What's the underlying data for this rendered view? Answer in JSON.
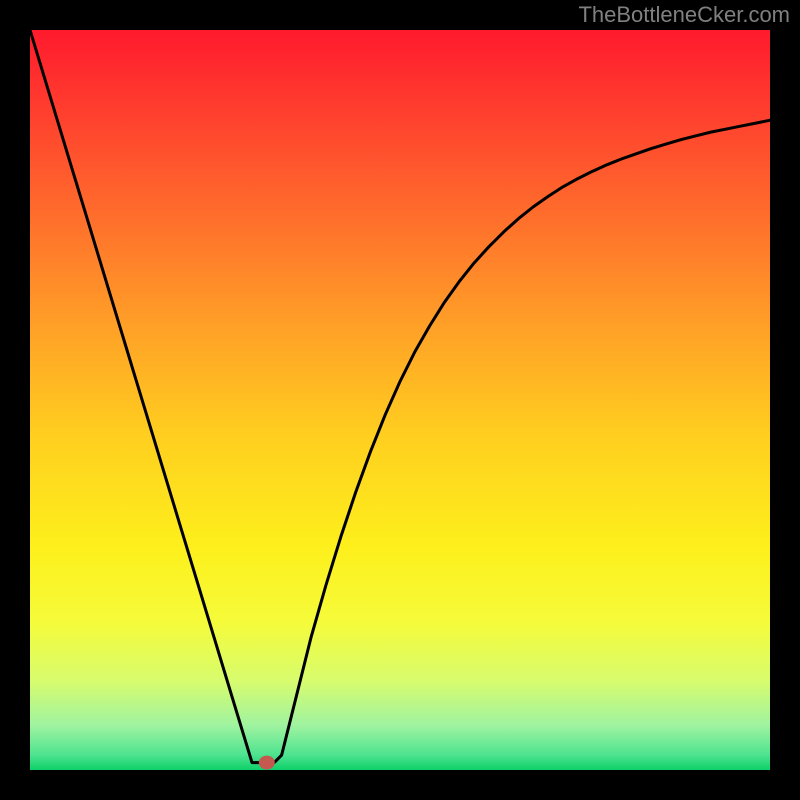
{
  "watermark": "TheBottleneCker.com",
  "chart_data": {
    "type": "line",
    "title": "",
    "xlabel": "",
    "ylabel": "",
    "xlim": [
      0,
      1
    ],
    "ylim": [
      0,
      1
    ],
    "x": [
      0.0,
      0.02,
      0.04,
      0.06,
      0.08,
      0.1,
      0.12,
      0.14,
      0.16,
      0.18,
      0.2,
      0.22,
      0.24,
      0.26,
      0.28,
      0.29,
      0.3,
      0.31,
      0.32,
      0.33,
      0.34,
      0.36,
      0.38,
      0.4,
      0.42,
      0.44,
      0.46,
      0.48,
      0.5,
      0.52,
      0.54,
      0.56,
      0.58,
      0.6,
      0.62,
      0.64,
      0.66,
      0.68,
      0.7,
      0.72,
      0.74,
      0.76,
      0.78,
      0.8,
      0.82,
      0.84,
      0.86,
      0.88,
      0.9,
      0.92,
      0.94,
      0.96,
      0.98,
      1.0
    ],
    "values": [
      1.0,
      0.934,
      0.868,
      0.802,
      0.736,
      0.67,
      0.604,
      0.538,
      0.472,
      0.406,
      0.34,
      0.274,
      0.208,
      0.142,
      0.076,
      0.043,
      0.01,
      0.01,
      0.01,
      0.01,
      0.02,
      0.1,
      0.18,
      0.25,
      0.315,
      0.375,
      0.43,
      0.48,
      0.525,
      0.565,
      0.6,
      0.632,
      0.66,
      0.685,
      0.707,
      0.727,
      0.745,
      0.761,
      0.775,
      0.788,
      0.799,
      0.809,
      0.818,
      0.826,
      0.833,
      0.84,
      0.846,
      0.852,
      0.857,
      0.862,
      0.866,
      0.87,
      0.874,
      0.878
    ],
    "marker": {
      "x": 0.32,
      "y": 0.01
    },
    "gradient_stops": [
      {
        "offset": 0.0,
        "color": "#ff1a2d"
      },
      {
        "offset": 0.1,
        "color": "#ff3b2e"
      },
      {
        "offset": 0.25,
        "color": "#ff6d2c"
      },
      {
        "offset": 0.4,
        "color": "#ffa027"
      },
      {
        "offset": 0.55,
        "color": "#ffcf1f"
      },
      {
        "offset": 0.7,
        "color": "#fdf01c"
      },
      {
        "offset": 0.8,
        "color": "#f5fb3a"
      },
      {
        "offset": 0.88,
        "color": "#d7fc6e"
      },
      {
        "offset": 0.94,
        "color": "#9ff3a0"
      },
      {
        "offset": 0.98,
        "color": "#4de38f"
      },
      {
        "offset": 1.0,
        "color": "#0dd168"
      }
    ],
    "curve_color": "#000000",
    "marker_color": "#c45a4f"
  }
}
